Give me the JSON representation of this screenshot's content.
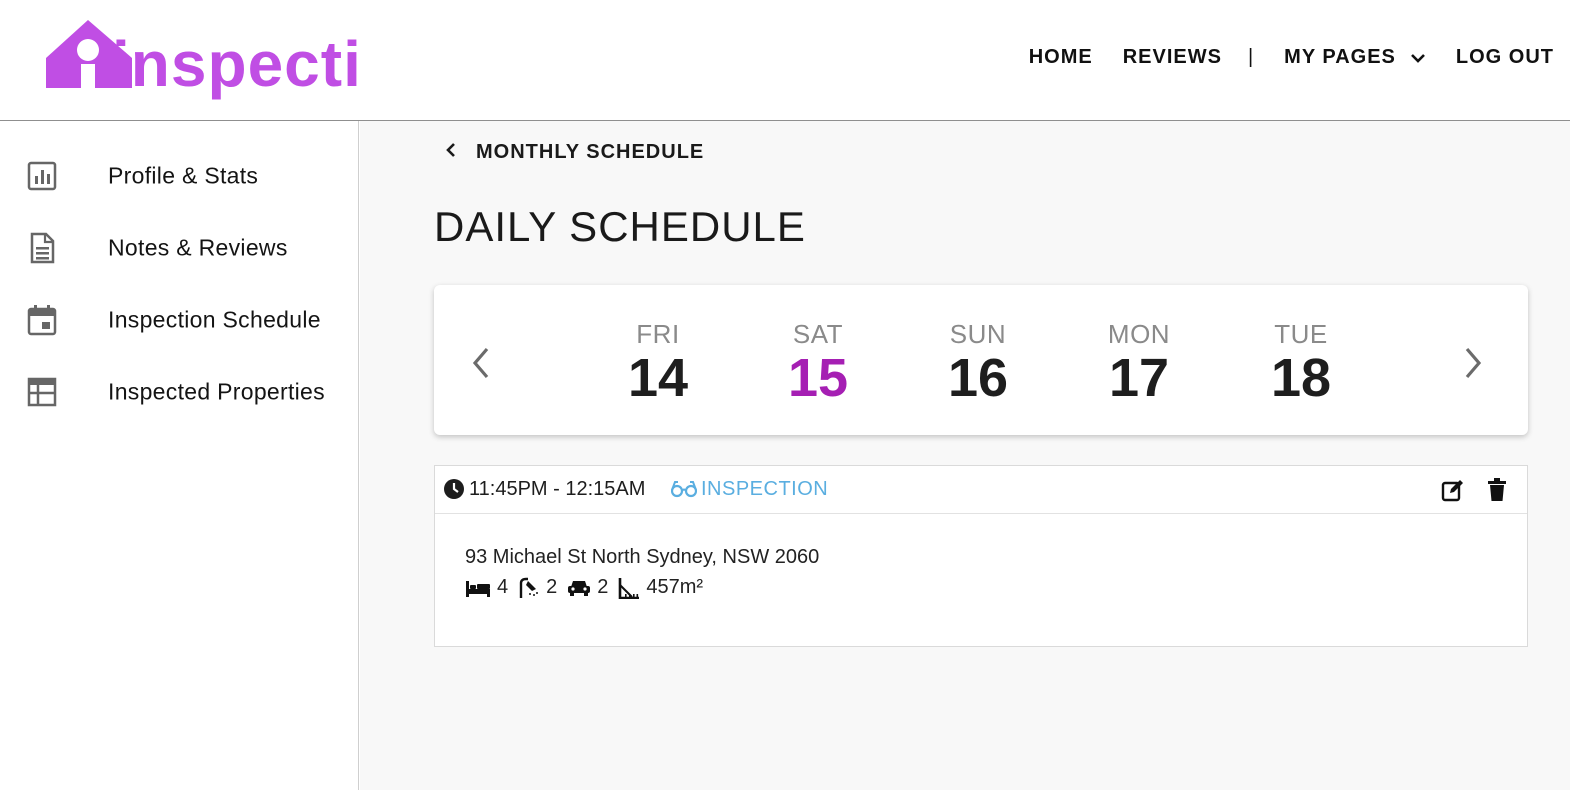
{
  "app": {
    "logo_text": "inspecti",
    "brand_color": "#c04ee4",
    "accent_color": "#a51fb3"
  },
  "nav": {
    "home": "HOME",
    "reviews": "REVIEWS",
    "separator": "|",
    "my_pages": "MY PAGES",
    "logout": "LOG OUT"
  },
  "sidebar": {
    "items": [
      {
        "label": "Profile & Stats",
        "icon": "bar-chart-icon"
      },
      {
        "label": "Notes & Reviews",
        "icon": "document-icon"
      },
      {
        "label": "Inspection Schedule",
        "icon": "calendar-icon"
      },
      {
        "label": "Inspected Properties",
        "icon": "table-icon"
      }
    ]
  },
  "main": {
    "back_label": "MONTHLY SCHEDULE",
    "title": "DAILY SCHEDULE",
    "days": [
      {
        "name": "FRI",
        "num": "14"
      },
      {
        "name": "SAT",
        "num": "15",
        "active": true
      },
      {
        "name": "SUN",
        "num": "16"
      },
      {
        "name": "MON",
        "num": "17"
      },
      {
        "name": "TUE",
        "num": "18"
      }
    ],
    "event": {
      "time": "11:45PM - 12:15AM",
      "type": "INSPECTION",
      "type_color": "#5aaee0",
      "address": "93 Michael St North Sydney, NSW 2060",
      "beds": "4",
      "baths": "2",
      "cars": "2",
      "area": "457m²"
    }
  }
}
